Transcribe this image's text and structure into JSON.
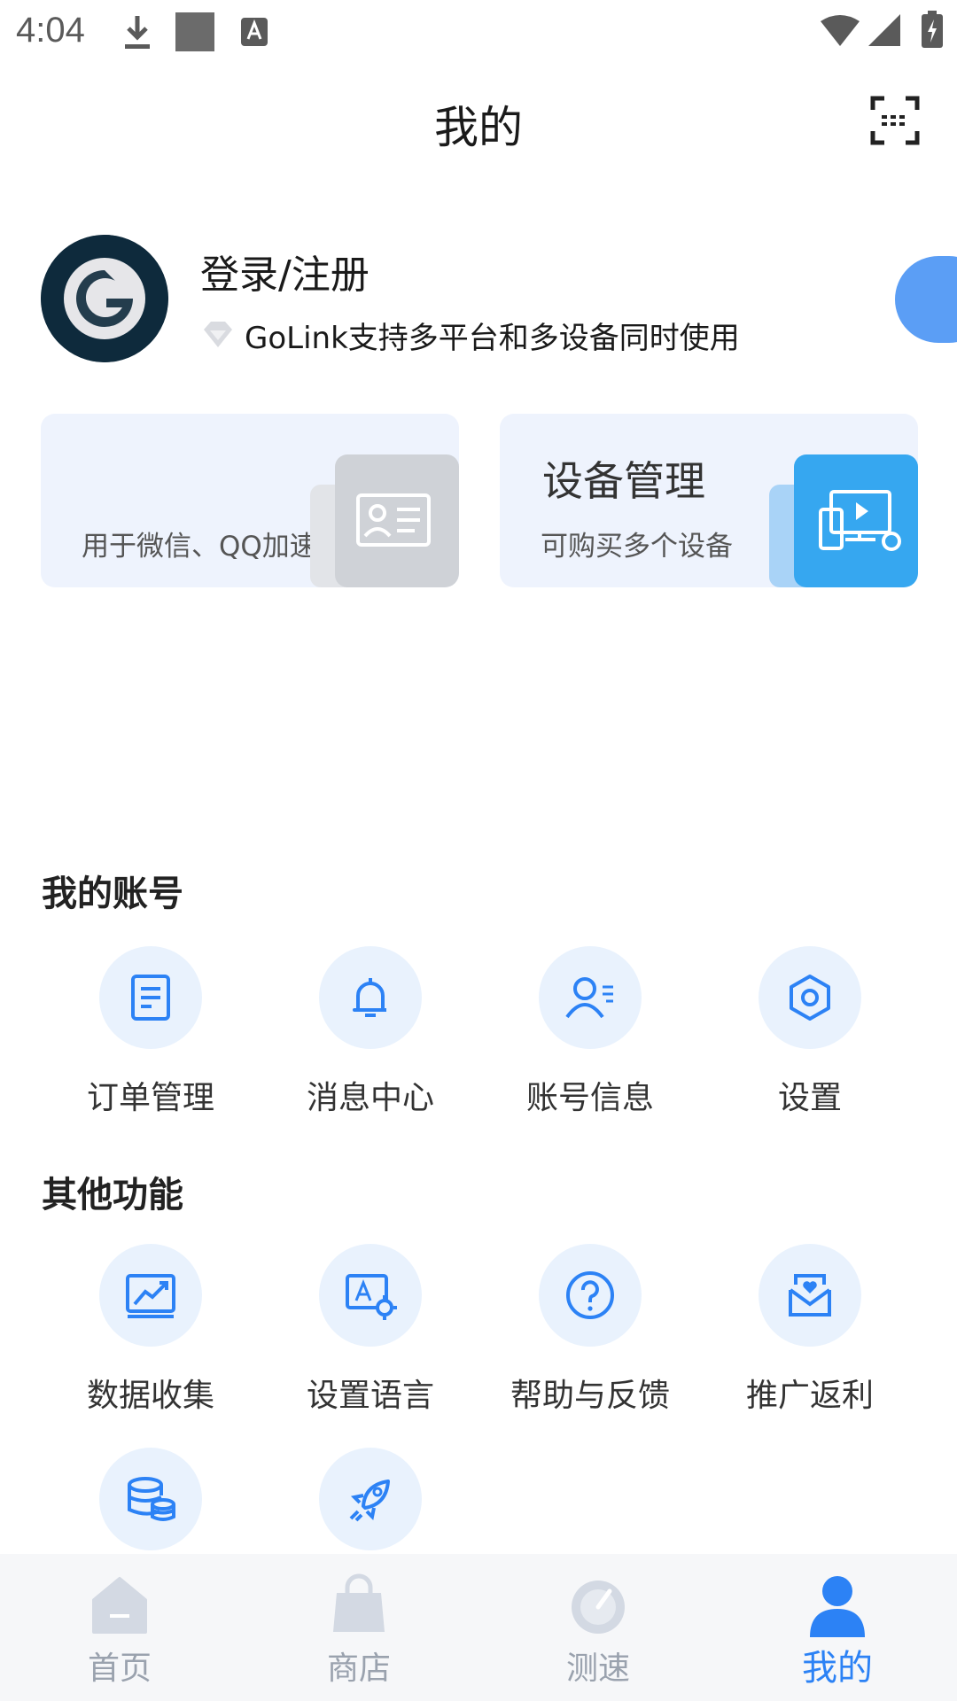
{
  "status_bar": {
    "time": "4:04",
    "icons": [
      "download-icon",
      "image-placeholder-icon",
      "text-a-icon",
      "wifi-icon",
      "signal-icon",
      "battery-charging-icon"
    ]
  },
  "header": {
    "title": "我的",
    "scan_icon": "scan-icon"
  },
  "profile": {
    "login_label": "登录/注册",
    "tagline": "GoLink支持多平台和多设备同时使用",
    "tagline_icon": "diamond-icon"
  },
  "cards": [
    {
      "title": "",
      "subtitle": "用于微信、QQ加速",
      "icon": "id-card-icon"
    },
    {
      "title": "设备管理",
      "subtitle": "可购买多个设备",
      "icon": "devices-settings-icon"
    }
  ],
  "sections": {
    "account": {
      "title": "我的账号",
      "items": [
        {
          "label": "订单管理",
          "icon": "order-icon"
        },
        {
          "label": "消息中心",
          "icon": "bell-icon"
        },
        {
          "label": "账号信息",
          "icon": "user-info-icon"
        },
        {
          "label": "设置",
          "icon": "hexagon-settings-icon"
        }
      ]
    },
    "other": {
      "title": "其他功能",
      "items": [
        {
          "label": "数据收集",
          "icon": "chart-icon"
        },
        {
          "label": "设置语言",
          "icon": "language-icon"
        },
        {
          "label": "帮助与反馈",
          "icon": "help-icon"
        },
        {
          "label": "推广返利",
          "icon": "mail-heart-icon"
        },
        {
          "label": "",
          "icon": "database-icon"
        },
        {
          "label": "",
          "icon": "rocket-icon"
        }
      ]
    }
  },
  "bottom_nav": {
    "items": [
      {
        "label": "首页",
        "icon": "home-icon"
      },
      {
        "label": "商店",
        "icon": "shopping-bag-icon"
      },
      {
        "label": "测速",
        "icon": "speedometer-icon"
      },
      {
        "label": "我的",
        "icon": "person-icon"
      }
    ],
    "active_index": 3
  },
  "colors": {
    "accent": "#2c82f5",
    "icon_bg": "#e9f2fd",
    "card_bg": "#eef3fd",
    "nav_inactive": "#9aa2ae"
  }
}
